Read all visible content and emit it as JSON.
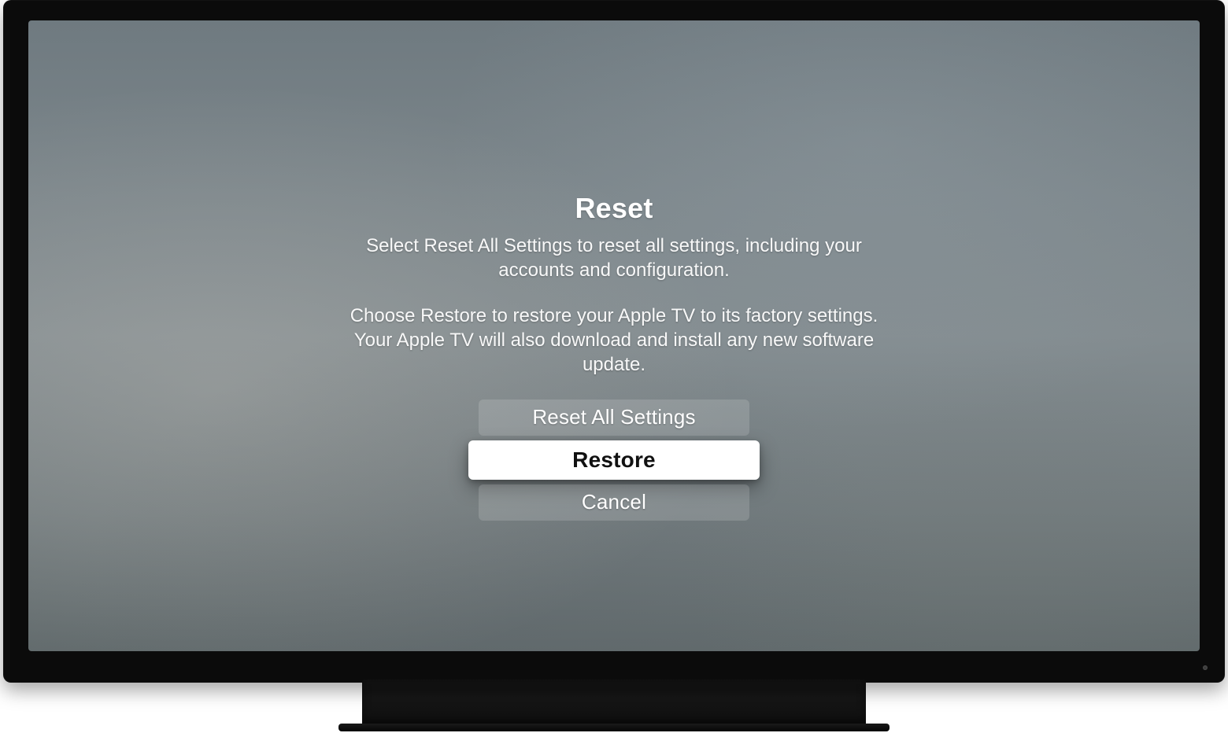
{
  "dialog": {
    "title": "Reset",
    "subtitle1": "Select Reset All Settings to reset all settings, including your accounts and configuration.",
    "subtitle2": "Choose Restore to restore your Apple TV to its factory settings. Your Apple TV will also download and install any new software update.",
    "options": {
      "reset_all": "Reset All Settings",
      "restore": "Restore",
      "cancel": "Cancel"
    },
    "focused": "restore"
  }
}
